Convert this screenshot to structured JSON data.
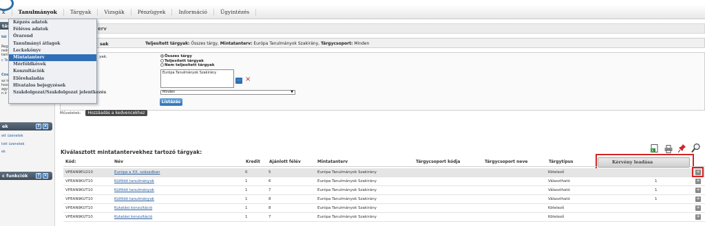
{
  "topnav": {
    "items": [
      "k",
      "Tanulmányok",
      "Tárgyak",
      "Vizsgák",
      "Pénzügyek",
      "Információ",
      "Ügyintézés"
    ]
  },
  "tanulmanyok_menu": {
    "items": [
      "Képzés adatok",
      "Féléves adatok",
      "Órarend",
      "Tanulmányi átlagok",
      "Leckekönyv",
      "Mintatanterv",
      "Mérföldkövek",
      "Konzultációk",
      "Előrehaladás",
      "Hivatalos bejegyzések",
      "Szakdolgozat/Szakdolgozat jelentkezés"
    ],
    "selected": "Mintatanterv"
  },
  "left": {
    "head1": "tás",
    "frag1": "tói",
    "frag2": [
      "Regi",
      "redm",
      "tanlá",
      "c Te"
    ],
    "link_frag": "Costi",
    "frag3": [
      "az ir",
      "hoza",
      "agy",
      "n ir"
    ],
    "panel_messages": "ek",
    "messages": [
      "ett üzenetek",
      "tott üzenetek",
      "ek"
    ],
    "panel_functions": "c funkciók"
  },
  "page": {
    "title_frag": "erv",
    "filter_label_frag": "sek",
    "summary": "Teljesített tárgyak: Összes tárgy, Mintatanterv: Európa Tanulmányok Szakirány, Tárgycsoport: Minden",
    "summary_parts": {
      "l1": "Teljesített tárgyak:",
      "v1": " Összes tárgy, ",
      "l2": "Mintatanterv:",
      "v2": " Európa Tanulmányok Szakirány, ",
      "l3": "Tárgycsoport:",
      "v3": " Minden"
    },
    "form_label1": "yak:",
    "form_label2": "",
    "form_label3": "",
    "radio_options": [
      "Összes tárgy",
      "Teljesített tárgyak",
      "Nem teljesített tárgyak"
    ],
    "radio_selected": 0,
    "plan_value": "Európa Tanulmányok Szakirány",
    "group_select_value": "Minden",
    "list_button": "Listázás",
    "actions_label": "Műveletek:",
    "favorites_button": "Hozzáadás a kedvencekhez",
    "section_title": "Kiválasztott mintatantervekhez tartozó tárgyak:",
    "request_button": "Kérvény leadása"
  },
  "table": {
    "headers": [
      "Kód:",
      "Név",
      "Kredit",
      "Ajánlott félév",
      "Mintatanterv",
      "Tárgycsoport kódja",
      "Tárgycsoport neve",
      "Tárgytípus"
    ],
    "rows": [
      {
        "code": "VPEAN9EU210",
        "name": "Európa a XX. században",
        "credit": "0",
        "sem": "5",
        "plan": "Európa Tanulmányok Szakirány",
        "type": "Kötelező",
        "num": ""
      },
      {
        "code": "VPEAN9KUT10",
        "name": "Külföldi tanulmányok",
        "credit": "1",
        "sem": "6",
        "plan": "Európa Tanulmányok Szakirány",
        "type": "Választható",
        "num": "1"
      },
      {
        "code": "VPEAN9KUT10",
        "name": "Külföldi tanulmányok",
        "credit": "1",
        "sem": "7",
        "plan": "Európa Tanulmányok Szakirány",
        "type": "Választható",
        "num": "1"
      },
      {
        "code": "VPEAN9KUT10",
        "name": "Külföldi tanulmányok",
        "credit": "1",
        "sem": "8",
        "plan": "Európa Tanulmányok Szakirány",
        "type": "Választható",
        "num": "1"
      },
      {
        "code": "VPEAN9KUT10",
        "name": "Kutatási konzultáció",
        "credit": "1",
        "sem": "8",
        "plan": "Európa Tanulmányok Szakirány",
        "type": "Kötelező",
        "num": ""
      },
      {
        "code": "VPEAN9KUT10",
        "name": "Kutatási konzultáció",
        "credit": "1",
        "sem": "7",
        "plan": "Európa Tanulmányok Szakirány",
        "type": "Kötelező",
        "num": ""
      }
    ]
  },
  "colors": {
    "accent": "#2f6fb7",
    "highlight": "#d32222",
    "header_dark": "#3f4d5c"
  },
  "icons": [
    "excel-icon",
    "print-icon",
    "pin-icon",
    "search-icon",
    "plus-icon",
    "cross-icon",
    "ellipsis-icon"
  ]
}
